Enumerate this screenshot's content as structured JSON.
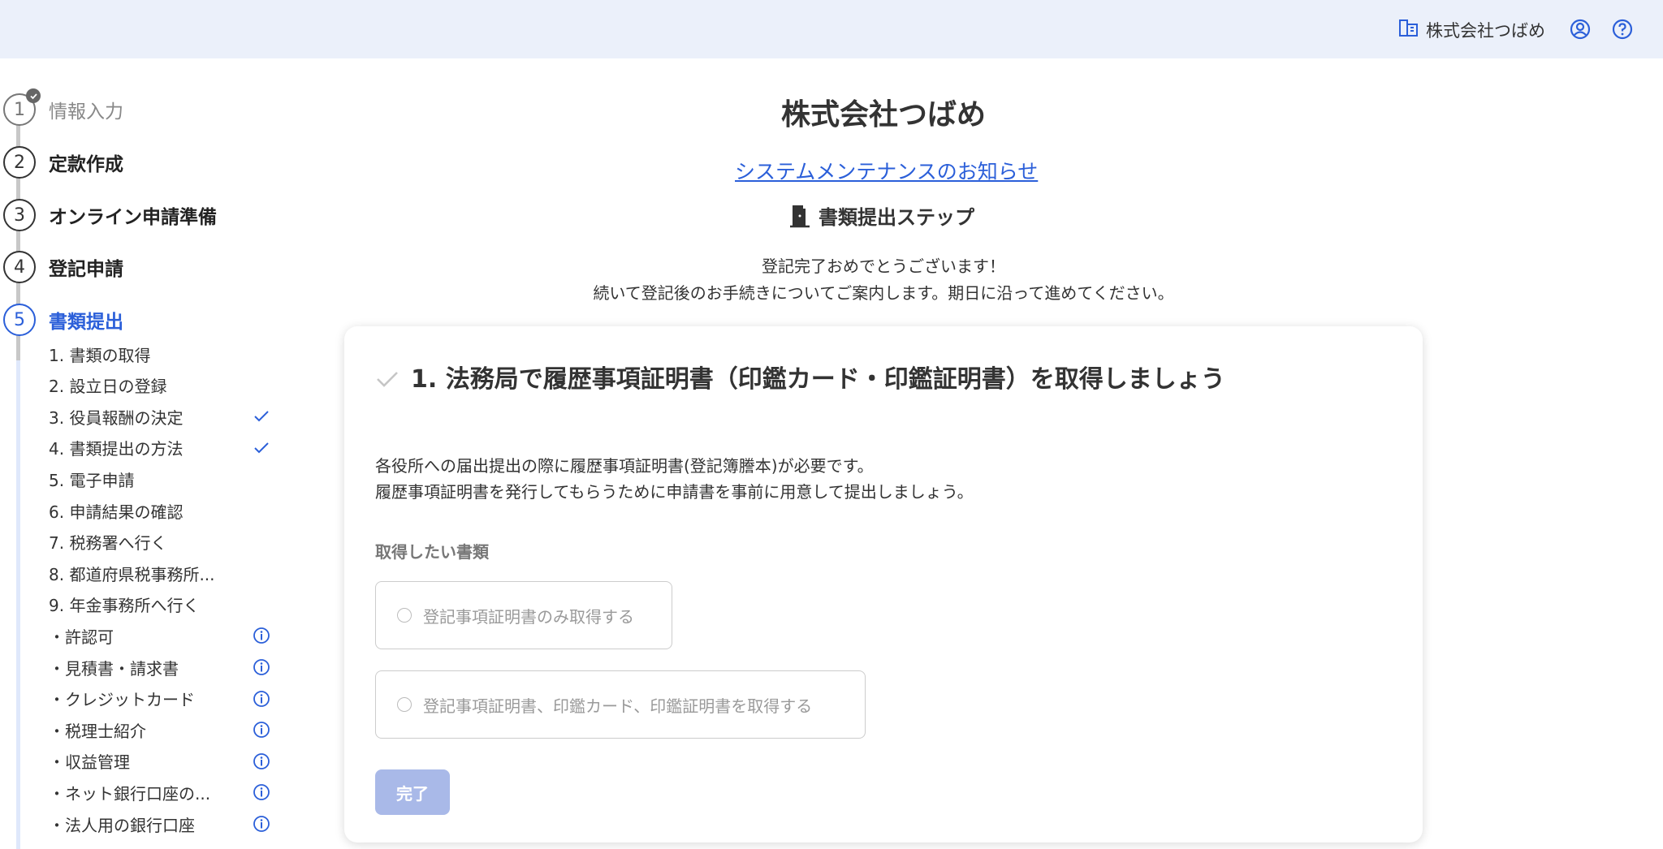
{
  "header": {
    "company_name": "株式会社つばめ",
    "icons": [
      "building-icon",
      "account-icon",
      "help-icon"
    ]
  },
  "sidebar": {
    "steps": [
      {
        "number": "1",
        "label": "情報入力",
        "state": "done"
      },
      {
        "number": "2",
        "label": "定款作成",
        "state": "todo"
      },
      {
        "number": "3",
        "label": "オンライン申請準備",
        "state": "todo"
      },
      {
        "number": "4",
        "label": "登記申請",
        "state": "todo"
      },
      {
        "number": "5",
        "label": "書類提出",
        "state": "active"
      }
    ],
    "subitems": [
      {
        "label": "1. 書類の取得",
        "icon": ""
      },
      {
        "label": "2. 設立日の登録",
        "icon": ""
      },
      {
        "label": "3. 役員報酬の決定",
        "icon": "check-icon"
      },
      {
        "label": "4. 書類提出の方法",
        "icon": "check-icon"
      },
      {
        "label": "5. 電子申請",
        "icon": ""
      },
      {
        "label": "6. 申請結果の確認",
        "icon": ""
      },
      {
        "label": "7. 税務署へ行く",
        "icon": ""
      },
      {
        "label": "8. 都道府県税事務所...",
        "icon": ""
      },
      {
        "label": "9. 年金事務所へ行く",
        "icon": ""
      },
      {
        "label": "・許認可",
        "icon": "info-icon"
      },
      {
        "label": "・見積書・請求書",
        "icon": "info-icon"
      },
      {
        "label": "・クレジットカード",
        "icon": "info-icon"
      },
      {
        "label": "・税理士紹介",
        "icon": "info-icon"
      },
      {
        "label": "・収益管理",
        "icon": "info-icon"
      },
      {
        "label": "・ネット銀行口座の...",
        "icon": "info-icon"
      },
      {
        "label": "・法人用の銀行口座",
        "icon": "info-icon"
      }
    ]
  },
  "main": {
    "title": "株式会社つばめ",
    "maintenance_link": "システムメンテナンスのお知らせ",
    "section_heading": "書類提出ステップ",
    "intro_line1": "登記完了おめでとうございます！",
    "intro_line2": "続いて登記後のお手続きについてご案内します。期日に沿って進めてください。",
    "card": {
      "title": "1. 法務局で履歴事項証明書（印鑑カード・印鑑証明書）を取得しましょう",
      "desc_line1": "各役所への届出提出の際に履歴事項証明書(登記簿謄本)が必要です。",
      "desc_line2": "履歴事項証明書を発行してもらうために申請書を事前に用意して提出しましょう。",
      "field_label": "取得したい書類",
      "options": [
        "登記事項証明書のみ取得する",
        "登記事項証明書、印鑑カード、印鑑証明書を取得する"
      ],
      "submit_label": "完了"
    }
  },
  "colors": {
    "accent": "#2b5fd9",
    "header_bg": "#ebf0fa",
    "button_disabled": "#a9b9e8"
  }
}
